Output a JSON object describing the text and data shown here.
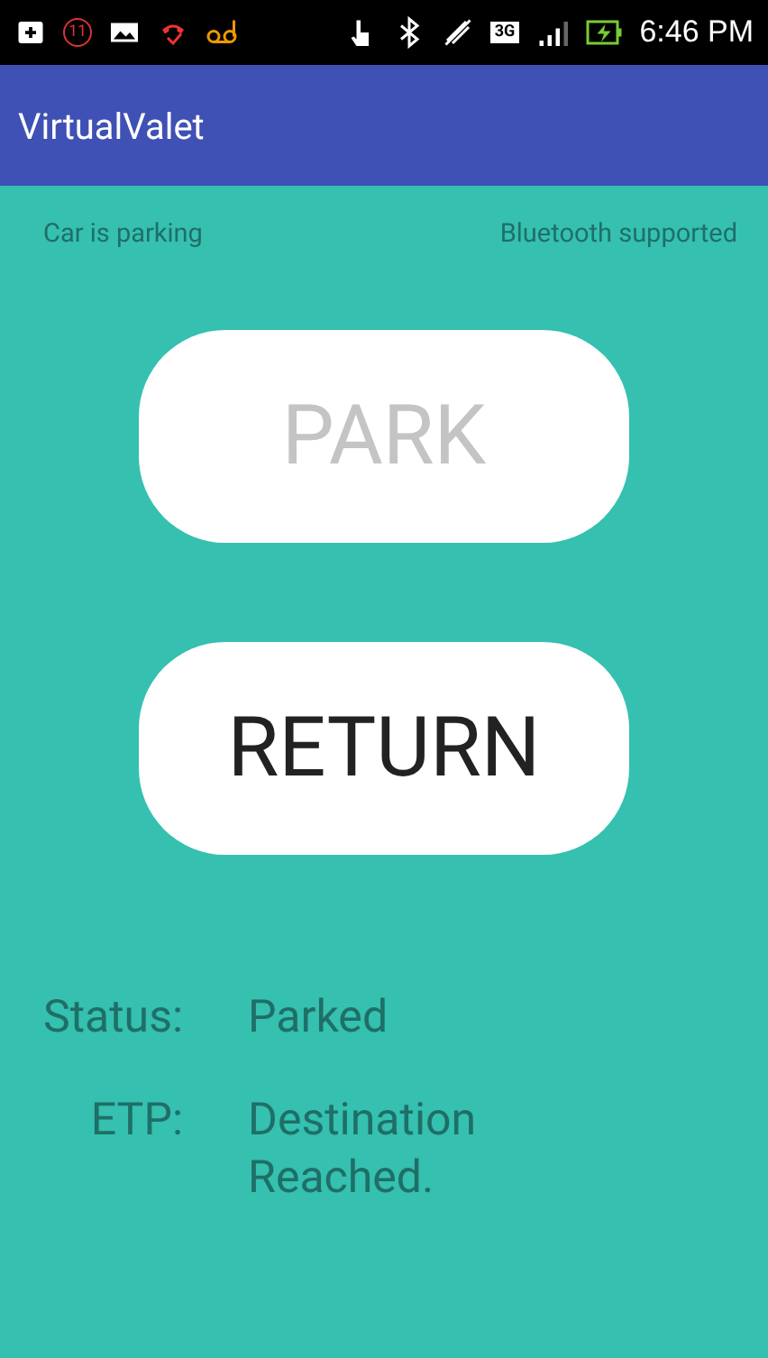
{
  "status_bar": {
    "notification_count": "11",
    "network": "3G",
    "time": "6:46 PM"
  },
  "app_bar": {
    "title": "VirtualValet"
  },
  "info": {
    "left": "Car is parking",
    "right": "Bluetooth supported"
  },
  "buttons": [
    {
      "label": "PARK",
      "disabled": true
    },
    {
      "label": "RETURN",
      "disabled": false
    }
  ],
  "details": [
    {
      "label": "Status:",
      "value": "Parked"
    },
    {
      "label": "ETP:",
      "value": "Destination Reached."
    }
  ]
}
